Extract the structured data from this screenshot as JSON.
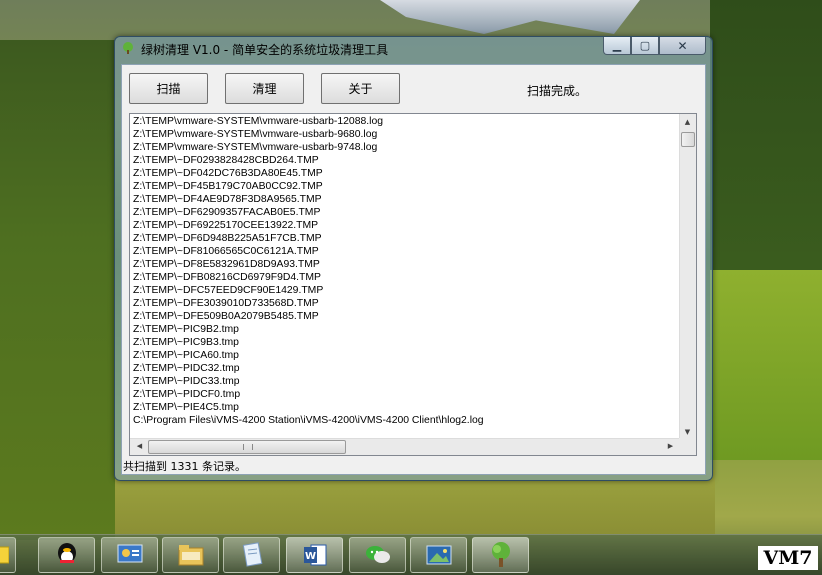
{
  "window": {
    "title": "绿树清理 V1.0 - 简单安全的系统垃圾清理工具",
    "controls": {
      "minimize": "▁",
      "maximize": "▢",
      "close": "✕"
    }
  },
  "toolbar": {
    "scan_label": "扫描",
    "clean_label": "清理",
    "about_label": "关于",
    "status": "扫描完成。"
  },
  "results": [
    "Z:\\TEMP\\vmware-SYSTEM\\vmware-usbarb-12088.log",
    "Z:\\TEMP\\vmware-SYSTEM\\vmware-usbarb-9680.log",
    "Z:\\TEMP\\vmware-SYSTEM\\vmware-usbarb-9748.log",
    "Z:\\TEMP\\~DF0293828428CBD264.TMP",
    "Z:\\TEMP\\~DF042DC76B3DA80E45.TMP",
    "Z:\\TEMP\\~DF45B179C70AB0CC92.TMP",
    "Z:\\TEMP\\~DF4AE9D78F3D8A9565.TMP",
    "Z:\\TEMP\\~DF62909357FACAB0E5.TMP",
    "Z:\\TEMP\\~DF69225170CEE13922.TMP",
    "Z:\\TEMP\\~DF6D948B225A51F7CB.TMP",
    "Z:\\TEMP\\~DF81066565C0C6121A.TMP",
    "Z:\\TEMP\\~DF8E5832961D8D9A93.TMP",
    "Z:\\TEMP\\~DFB08216CD6979F9D4.TMP",
    "Z:\\TEMP\\~DFC57EED9CF90E1429.TMP",
    "Z:\\TEMP\\~DFE3039010D733568D.TMP",
    "Z:\\TEMP\\~DFE509B0A2079B5485.TMP",
    "Z:\\TEMP\\~PIC9B2.tmp",
    "Z:\\TEMP\\~PIC9B3.tmp",
    "Z:\\TEMP\\~PICA60.tmp",
    "Z:\\TEMP\\~PIDC32.tmp",
    "Z:\\TEMP\\~PIDC33.tmp",
    "Z:\\TEMP\\~PIDCF0.tmp",
    "Z:\\TEMP\\~PIE4C5.tmp",
    "C:\\Program Files\\iVMS-4200 Station\\iVMS-4200\\iVMS-4200 Client\\hlog2.log"
  ],
  "statusbar": {
    "text": "共扫描到 1331 条记录。"
  },
  "taskbar": {
    "items": [
      "sticky-notes-icon",
      "qq-icon",
      "control-panel-icon",
      "file-explorer-icon",
      "notepad-icon",
      "word-icon",
      "wechat-icon",
      "photo-viewer-icon",
      "green-tree-app-icon"
    ],
    "badge": "VM7"
  },
  "colors": {
    "accent": "#4a8a2a",
    "window_frame": "#7aa0be"
  }
}
